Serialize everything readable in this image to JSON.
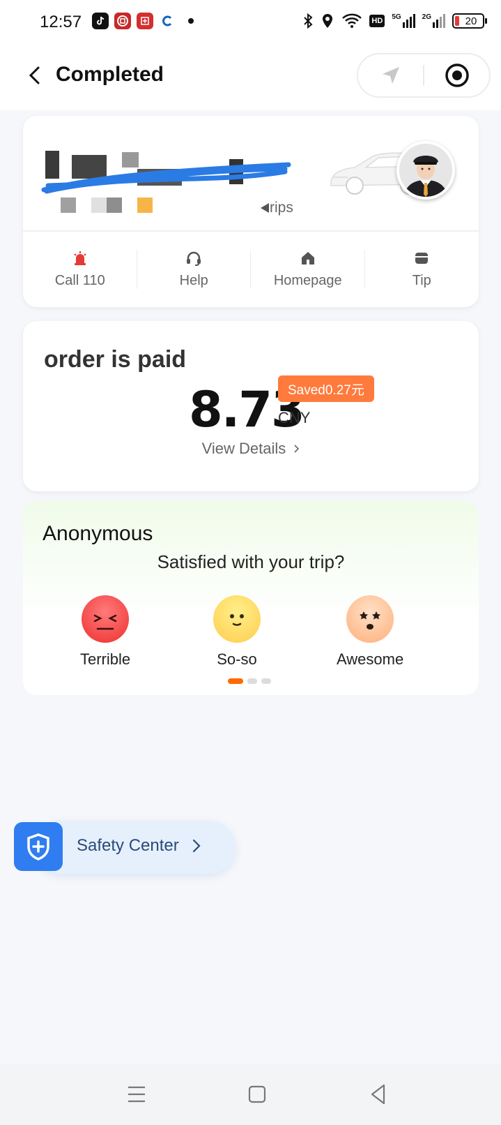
{
  "status_bar": {
    "time": "12:57",
    "apps": [
      {
        "icon": "tiktok-icon",
        "color": "#111111"
      },
      {
        "icon": "bank-icon",
        "color": "#c62828"
      },
      {
        "icon": "netease-icon",
        "color": "#d32f2f"
      },
      {
        "icon": "app-c-icon",
        "color": "#1565c0"
      }
    ],
    "icons": [
      "bluetooth-icon",
      "location-icon",
      "wifi-icon",
      "hd-icon",
      "signal-5g-icon",
      "signal-2g-icon"
    ],
    "hd_label": "HD",
    "net_5g": "5G",
    "net_2g": "2G",
    "battery": "20"
  },
  "header": {
    "title": "Completed",
    "back_icon": "back-arrow-icon",
    "actions": [
      "navigate-arrow-icon",
      "record-icon"
    ]
  },
  "driver_card": {
    "trips_label": "rips",
    "actions": [
      {
        "label": "Call 110",
        "icon": "alarm-icon",
        "color": "#e53935"
      },
      {
        "label": "Help",
        "icon": "headset-icon",
        "color": "#555555"
      },
      {
        "label": "Homepage",
        "icon": "home-icon",
        "color": "#555555"
      },
      {
        "label": "Tip",
        "icon": "wallet-icon",
        "color": "#555555"
      }
    ]
  },
  "payment": {
    "status": "order is paid",
    "amount": "8.73",
    "currency": "CNY",
    "saved_badge": "Saved0.27元",
    "view_details": "View Details",
    "badge_color": "#ff7a3d"
  },
  "rating": {
    "user": "Anonymous",
    "question": "Satisfied with your trip?",
    "options": [
      {
        "label": "Terrible",
        "icon": "angry-face-icon"
      },
      {
        "label": "So-so",
        "icon": "neutral-face-icon"
      },
      {
        "label": "Awesome",
        "icon": "star-eyes-face-icon"
      }
    ],
    "page_indicator": {
      "current": 1,
      "total": 3
    }
  },
  "safety_center": {
    "label": "Safety Center",
    "icon": "shield-plus-icon",
    "color": "#2f7df0"
  },
  "system_nav": [
    "menu-icon",
    "home-square-icon",
    "back-icon"
  ]
}
